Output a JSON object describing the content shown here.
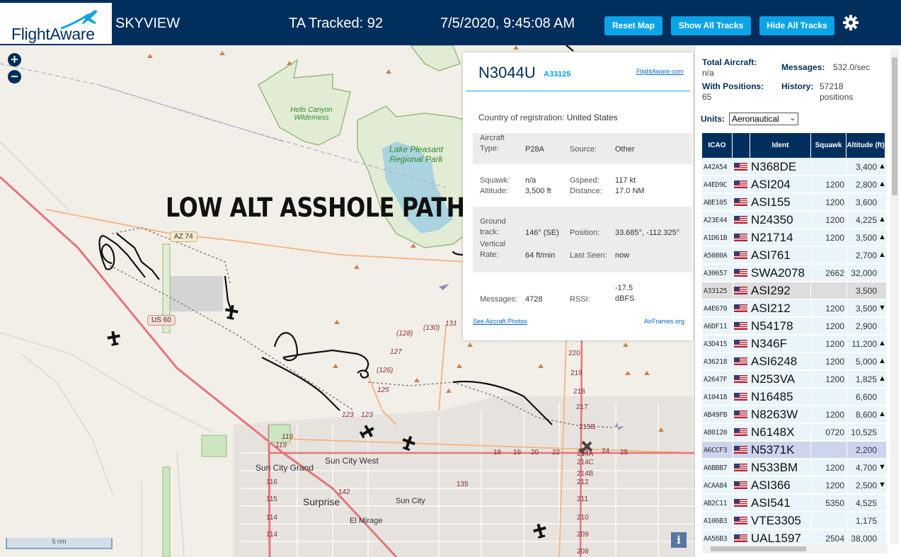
{
  "header": {
    "logo_text": "FlightAware",
    "app_name": "SKYVIEW",
    "tracked": "TA Tracked: 92",
    "clock": "7/5/2020, 9:45:08 AM",
    "btn_reset": "Reset Map",
    "btn_show": "Show All Tracks",
    "btn_hide": "Hide All Tracks",
    "brand_color": "#002F5D",
    "button_color": "#0CA4E6"
  },
  "map": {
    "zoom_in": "+",
    "zoom_out": "−",
    "scale": "5 nm",
    "info": "i",
    "annotation": "LOW ALT ASSHOLE PATH",
    "places": {
      "hells_canyon": "Hells Canyon Wilderness",
      "lake_pleasant": "Lake Pleasant Regional Park",
      "sun_city_grand": "Sun City Grand",
      "sun_city_west": "Sun City West",
      "surprise": "Surprise",
      "sun_city": "Sun City",
      "el_mirage": "El Mirage"
    },
    "shields": {
      "az74": "AZ 74",
      "us60": "US 60"
    },
    "route_numbers": {
      "r128": "(128)",
      "r130": "(130)",
      "r131": "131",
      "r127": "127",
      "r126": "(126)",
      "r125": "125",
      "r123a": "123",
      "r123b": "123",
      "r119a": "119",
      "r119b": "119",
      "r18": "18",
      "r19": "19",
      "r20": "20",
      "r22": "22",
      "r23": "23",
      "r24": "24",
      "r25": "25",
      "r220": "220",
      "r219": "219",
      "r218": "218",
      "r217": "217",
      "r215b": "215B",
      "r214c": "214C",
      "r214b": "214B",
      "r214a": "214A",
      "r214": "214",
      "r212": "212",
      "r211": "211",
      "r210": "210",
      "r209": "209",
      "r208": "208",
      "r116": "116",
      "r115": "115",
      "r114a": "114",
      "r114b": "114",
      "r142": "142",
      "r135": "135"
    }
  },
  "popup": {
    "registration": "N3044U",
    "hex": "A33125",
    "fa_link": "FlightAware.com",
    "country_label": "Country of registration:",
    "country_value": "United States",
    "aircraft_type_label": "Aircraft Type:",
    "aircraft_type_value": "P28A",
    "source_label": "Source:",
    "source_value": "Other",
    "squawk_label": "Squawk:",
    "squawk_value": "n/a",
    "altitude_label": "Altitude:",
    "altitude_value": "3,500 ft",
    "gspeed_label": "Gspeed:",
    "gspeed_value": "117 kt",
    "distance_label": "Distance:",
    "distance_value": "17.0 NM",
    "ground_track_label": "Ground track:",
    "ground_track_value": "146° (SE)",
    "position_label": "Position:",
    "position_value": "33.685°, -112.325°",
    "vertical_rate_label": "Vertical Rate:",
    "vertical_rate_value": "64 ft/min",
    "last_seen_label": "Last Seen:",
    "last_seen_value": "now",
    "messages_label": "Messages:",
    "messages_value": "4728",
    "rssi_label": "RSSI:",
    "rssi_value": "-17.5 dBFS",
    "photos_link": "See Aircraft Photos",
    "airframes_link": "AirFrames.org"
  },
  "sidebar": {
    "total_label": "Total Aircraft:",
    "total_value": "n/a",
    "messages_label": "Messages:",
    "messages_value": "532.0/sec",
    "with_pos_label": "With Positions:",
    "with_pos_value": "65",
    "history_label": "History:",
    "history_value": "57218 positions",
    "units_label": "Units:",
    "units_value": "Aeronautical",
    "columns": [
      "ICAO",
      "",
      "Ident",
      "Squawk",
      "Altitude (ft)"
    ],
    "rows": [
      {
        "icao": "A42A54",
        "ident": "N368DE",
        "squawk": "",
        "alt": "3,400",
        "trend": "▲"
      },
      {
        "icao": "A4ED9C",
        "ident": "ASI204",
        "squawk": "1200",
        "alt": "2,800",
        "trend": "▲"
      },
      {
        "icao": "ABE105",
        "ident": "ASI155",
        "squawk": "1200",
        "alt": "3,600",
        "trend": ""
      },
      {
        "icao": "A23E44",
        "ident": "N24350",
        "squawk": "1200",
        "alt": "4,225",
        "trend": "▲"
      },
      {
        "icao": "A1D61B",
        "ident": "N21714",
        "squawk": "1200",
        "alt": "3,500",
        "trend": "▲"
      },
      {
        "icao": "A5080A",
        "ident": "ASI761",
        "squawk": "",
        "alt": "2,700",
        "trend": "▲"
      },
      {
        "icao": "A30657",
        "ident": "SWA2078",
        "squawk": "2662",
        "alt": "32,000",
        "trend": ""
      },
      {
        "icao": "A33125",
        "ident": "ASI292",
        "squawk": "",
        "alt": "3,500",
        "trend": ""
      },
      {
        "icao": "A4E670",
        "ident": "ASI212",
        "squawk": "1200",
        "alt": "3,500",
        "trend": "▼"
      },
      {
        "icao": "A6DF11",
        "ident": "N54178",
        "squawk": "1200",
        "alt": "2,900",
        "trend": ""
      },
      {
        "icao": "A3D415",
        "ident": "N346F",
        "squawk": "1200",
        "alt": "11,200",
        "trend": "▲"
      },
      {
        "icao": "A36218",
        "ident": "ASI6248",
        "squawk": "1200",
        "alt": "5,000",
        "trend": "▲"
      },
      {
        "icao": "A2647F",
        "ident": "N253VA",
        "squawk": "1200",
        "alt": "1,825",
        "trend": "▲"
      },
      {
        "icao": "A10418",
        "ident": "N16485",
        "squawk": "",
        "alt": "6,600",
        "trend": ""
      },
      {
        "icao": "AB49FB",
        "ident": "N8263W",
        "squawk": "1200",
        "alt": "8,600",
        "trend": "▲"
      },
      {
        "icao": "A80120",
        "ident": "N6148X",
        "squawk": "0720",
        "alt": "10,525",
        "trend": ""
      },
      {
        "icao": "A6CCF3",
        "ident": "N5371K",
        "squawk": "",
        "alt": "2,200",
        "trend": ""
      },
      {
        "icao": "A6BBB7",
        "ident": "N533BM",
        "squawk": "1200",
        "alt": "4,700",
        "trend": "▼"
      },
      {
        "icao": "ACAA84",
        "ident": "ASI366",
        "squawk": "1200",
        "alt": "2,500",
        "trend": "▼"
      },
      {
        "icao": "AB2C11",
        "ident": "ASI541",
        "squawk": "5350",
        "alt": "4,525",
        "trend": ""
      },
      {
        "icao": "A106B3",
        "ident": "VTE3305",
        "squawk": "",
        "alt": "1,175",
        "trend": ""
      },
      {
        "icao": "AA56B3",
        "ident": "UAL1597",
        "squawk": "2504",
        "alt": "38,000",
        "trend": ""
      }
    ]
  }
}
